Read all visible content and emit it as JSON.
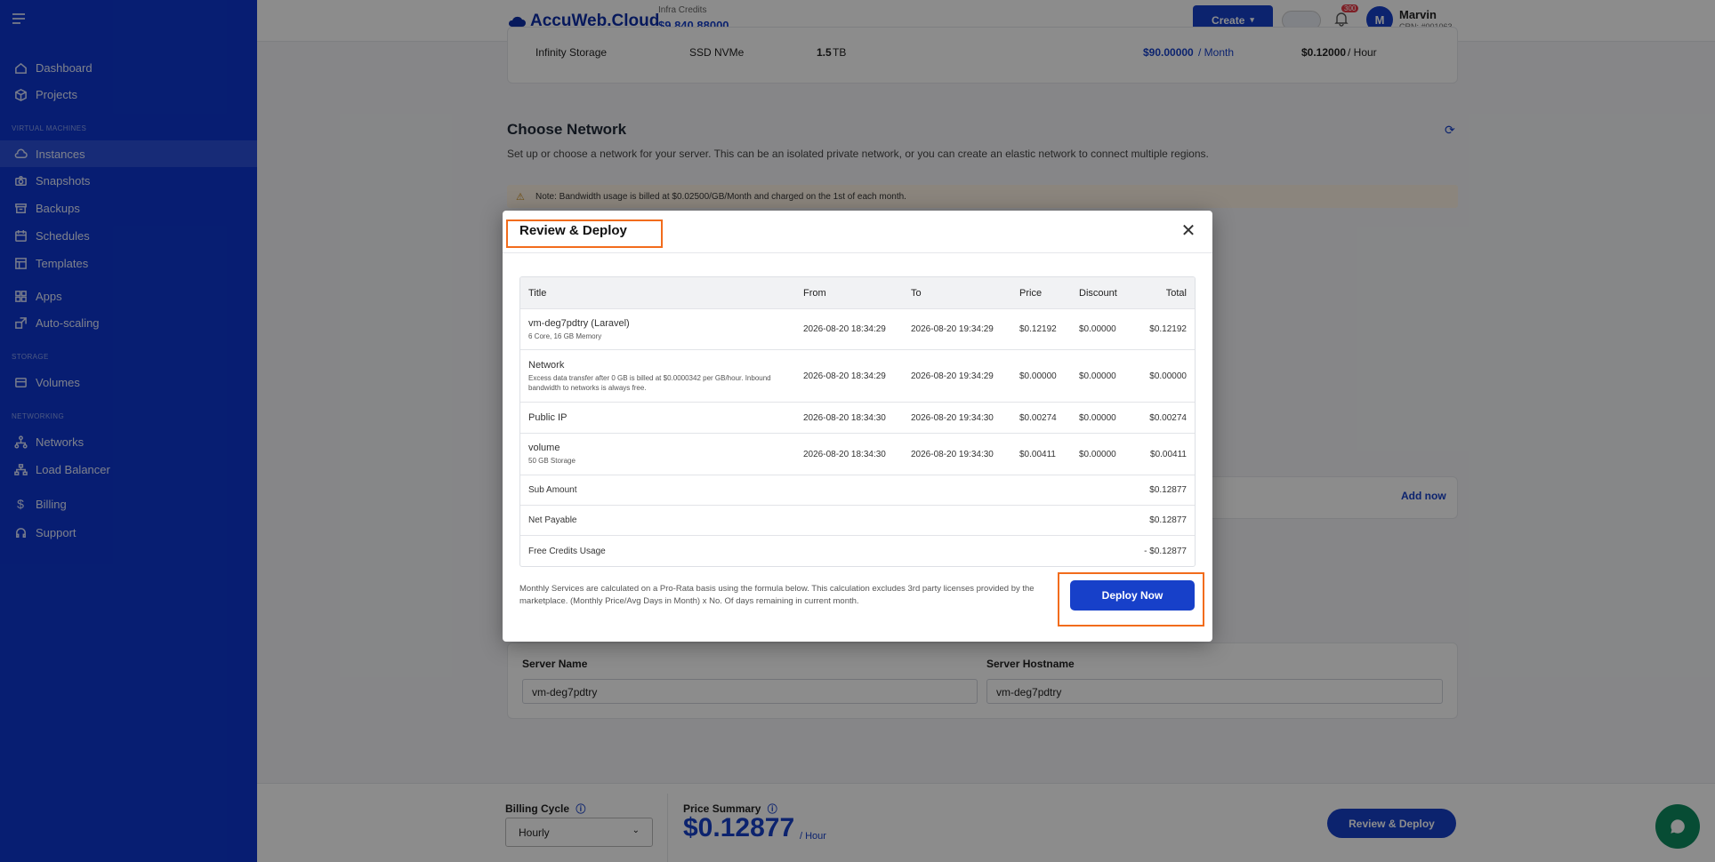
{
  "sidebar": {
    "items": [
      {
        "label": "Dashboard",
        "icon": "home-icon"
      },
      {
        "label": "Projects",
        "icon": "box-icon"
      },
      {
        "label": "Instances",
        "icon": "cloud-icon"
      },
      {
        "label": "Snapshots",
        "icon": "camera-icon"
      },
      {
        "label": "Backups",
        "icon": "archive-icon"
      },
      {
        "label": "Schedules",
        "icon": "calendar-icon"
      },
      {
        "label": "Templates",
        "icon": "template-icon"
      },
      {
        "label": "Apps",
        "icon": "grid-icon"
      },
      {
        "label": "Auto-scaling",
        "icon": "scale-icon"
      },
      {
        "label": "Volumes",
        "icon": "database-icon"
      },
      {
        "label": "Networks",
        "icon": "network-icon"
      },
      {
        "label": "Load Balancer",
        "icon": "balance-icon"
      },
      {
        "label": "Billing",
        "icon": "dollar-icon"
      },
      {
        "label": "Support",
        "icon": "headset-icon"
      }
    ],
    "sections": [
      "VIRTUAL MACHINES",
      "STORAGE",
      "NETWORKING"
    ]
  },
  "header": {
    "logo": "AccuWeb.Cloud",
    "credits_label": "Infra Credits",
    "credits_value": "$9,840.88000",
    "create_label": "Create",
    "notifications": "300",
    "avatar": "M",
    "user_name": "Marvin",
    "user_crn": "CRN: #001063"
  },
  "background": {
    "storage_name": "Infinity Storage",
    "storage_type": "SSD NVMe",
    "storage_size": "1.5",
    "storage_unit": "TB",
    "storage_monthly": "$90.00000",
    "storage_monthly_unit": "/ Month",
    "storage_hourly": "$0.12000",
    "storage_hourly_unit": "/ Hour",
    "network_title": "Choose Network",
    "network_desc": "Set up or choose a network for your server. This can be an isolated private network, or you can create an elastic network to connect multiple regions.",
    "note": "Note: Bandwidth usage is billed at $0.02500/GB/Month and charged on the 1st of each month.",
    "add_now": "Add now",
    "server_name_label": "Server Name",
    "server_name_value": "vm-deg7pdtry",
    "server_host_label": "Server Hostname",
    "server_host_value": "vm-deg7pdtry"
  },
  "bottom": {
    "billing_cycle_label": "Billing Cycle",
    "billing_cycle_value": "Hourly",
    "price_summary_label": "Price Summary",
    "price_value": "$0.12877",
    "price_unit": "/ Hour",
    "review_label": "Review & Deploy"
  },
  "modal": {
    "title": "Review & Deploy",
    "columns": [
      "Title",
      "From",
      "To",
      "Price",
      "Discount",
      "Total"
    ],
    "rows": [
      {
        "title": "vm-deg7pdtry (Laravel)",
        "sub": "6 Core, 16 GB Memory",
        "from": "2026-08-20 18:34:29",
        "to": "2026-08-20 19:34:29",
        "price": "$0.12192",
        "discount": "$0.00000",
        "total": "$0.12192"
      },
      {
        "title": "Network",
        "sub": "Excess data transfer after 0 GB is billed at $0.0000342 per GB/hour. Inbound bandwidth to networks is always free.",
        "from": "2026-08-20 18:34:29",
        "to": "2026-08-20 19:34:29",
        "price": "$0.00000",
        "discount": "$0.00000",
        "total": "$0.00000"
      },
      {
        "title": "Public IP",
        "sub": "",
        "from": "2026-08-20 18:34:30",
        "to": "2026-08-20 19:34:30",
        "price": "$0.00274",
        "discount": "$0.00000",
        "total": "$0.00274"
      },
      {
        "title": "volume",
        "sub": "50 GB Storage",
        "from": "2026-08-20 18:34:30",
        "to": "2026-08-20 19:34:30",
        "price": "$0.00411",
        "discount": "$0.00000",
        "total": "$0.00411"
      }
    ],
    "summary": [
      {
        "label": "Sub Amount",
        "value": "$0.12877"
      },
      {
        "label": "Net Payable",
        "value": "$0.12877"
      },
      {
        "label": "Free Credits Usage",
        "value": "- $0.12877"
      }
    ],
    "footnote": "Monthly Services are calculated on a Pro-Rata basis using the formula below. This calculation excludes 3rd party licenses provided by the marketplace. (Monthly Price/Avg Days in Month) x No. Of days remaining in current month.",
    "deploy_label": "Deploy Now",
    "close_symbol": "✕"
  },
  "colors": {
    "sidebar": "#0d36cf",
    "accent": "#1740c9",
    "highlight": "#f26c1c"
  }
}
